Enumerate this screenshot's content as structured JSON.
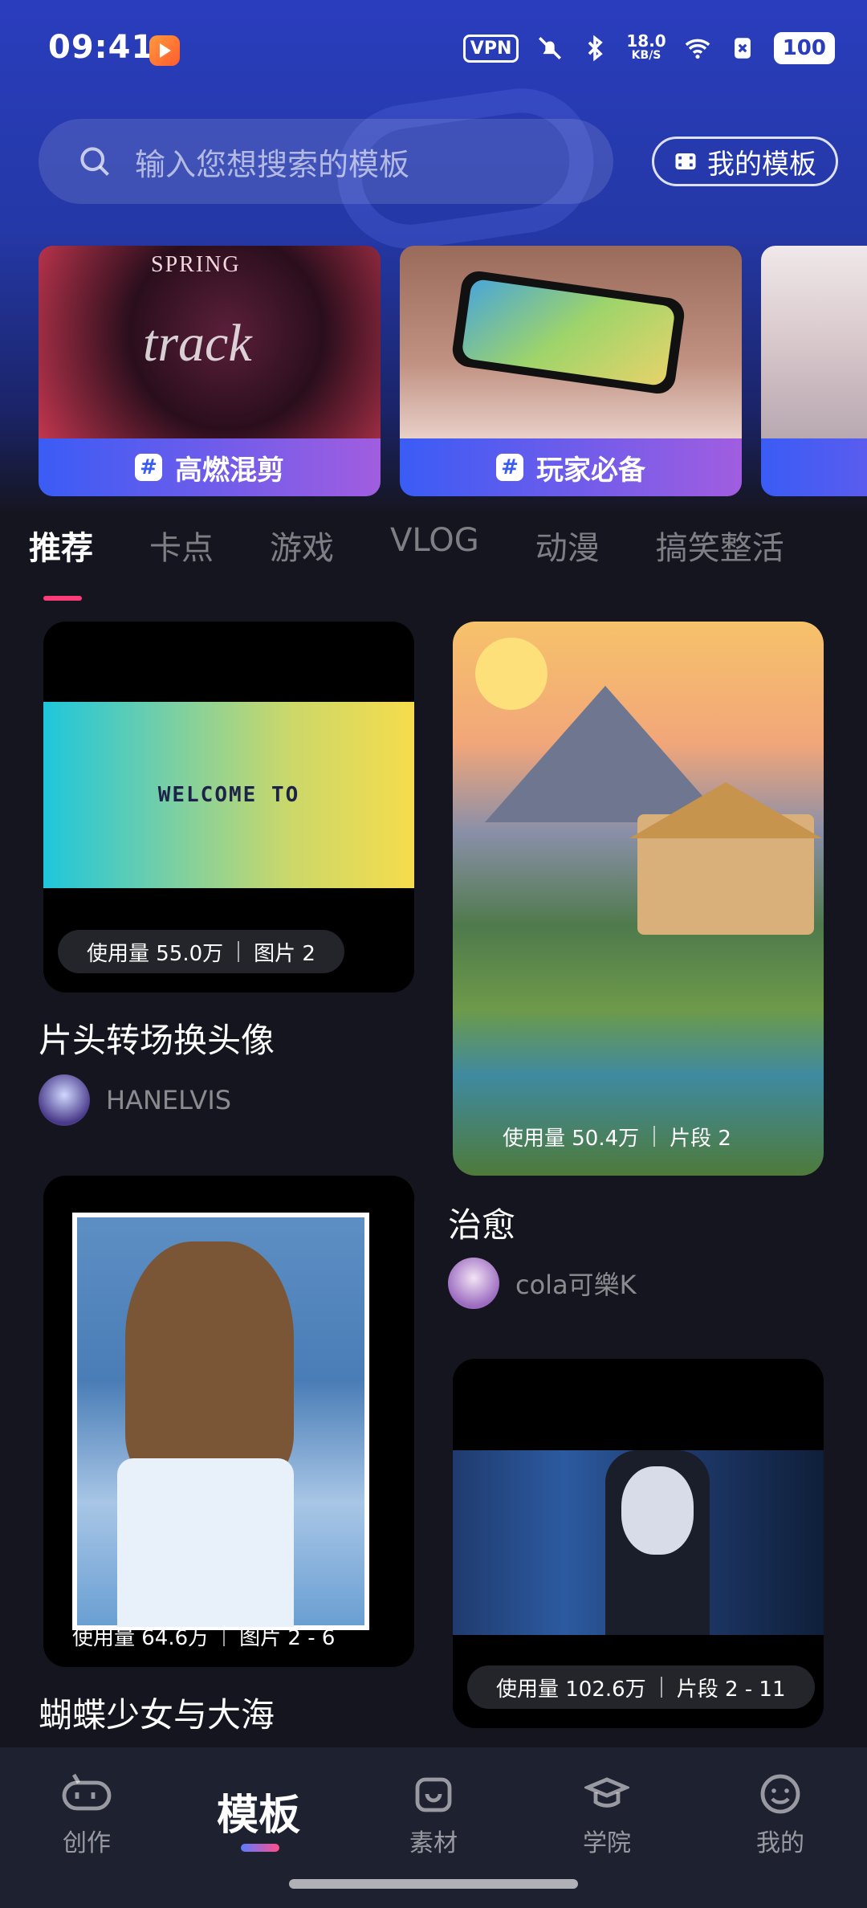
{
  "status_bar": {
    "time": "09:41",
    "vpn": "VPN",
    "speed_value": "18.0",
    "speed_unit": "KB/S",
    "battery": "100"
  },
  "search": {
    "placeholder": "输入您想搜索的模板",
    "my_templates_label": "我的模板"
  },
  "banners": [
    {
      "label": "高燃混剪"
    },
    {
      "label": "玩家必备"
    },
    {
      "label": ""
    }
  ],
  "tabs": [
    "推荐",
    "卡点",
    "游戏",
    "VLOG",
    "动漫",
    "搞笑整活"
  ],
  "cards": {
    "left_1": {
      "preview_text": "WELCOME TO",
      "usage": "使用量 55.0万",
      "meta": "图片 2",
      "title": "片头转场换头像",
      "author": "HANELVIS"
    },
    "right_1": {
      "usage": "使用量 50.4万",
      "meta": "片段 2",
      "title": "治愈",
      "author": "cola可樂K"
    },
    "left_2": {
      "usage": "使用量 64.6万",
      "meta": "图片 2 - 6",
      "title": "蝴蝶少女与大海"
    },
    "right_2": {
      "usage": "使用量 102.6万",
      "meta": "片段 2 - 11"
    }
  },
  "bottom_nav": {
    "create": "创作",
    "templates": "模板",
    "materials": "素材",
    "academy": "学院",
    "mine": "我的"
  },
  "colors": {
    "accent_pink": "#ff3c78",
    "banner_gradient_start": "#3a5cf5",
    "banner_gradient_end": "#a15de0"
  }
}
